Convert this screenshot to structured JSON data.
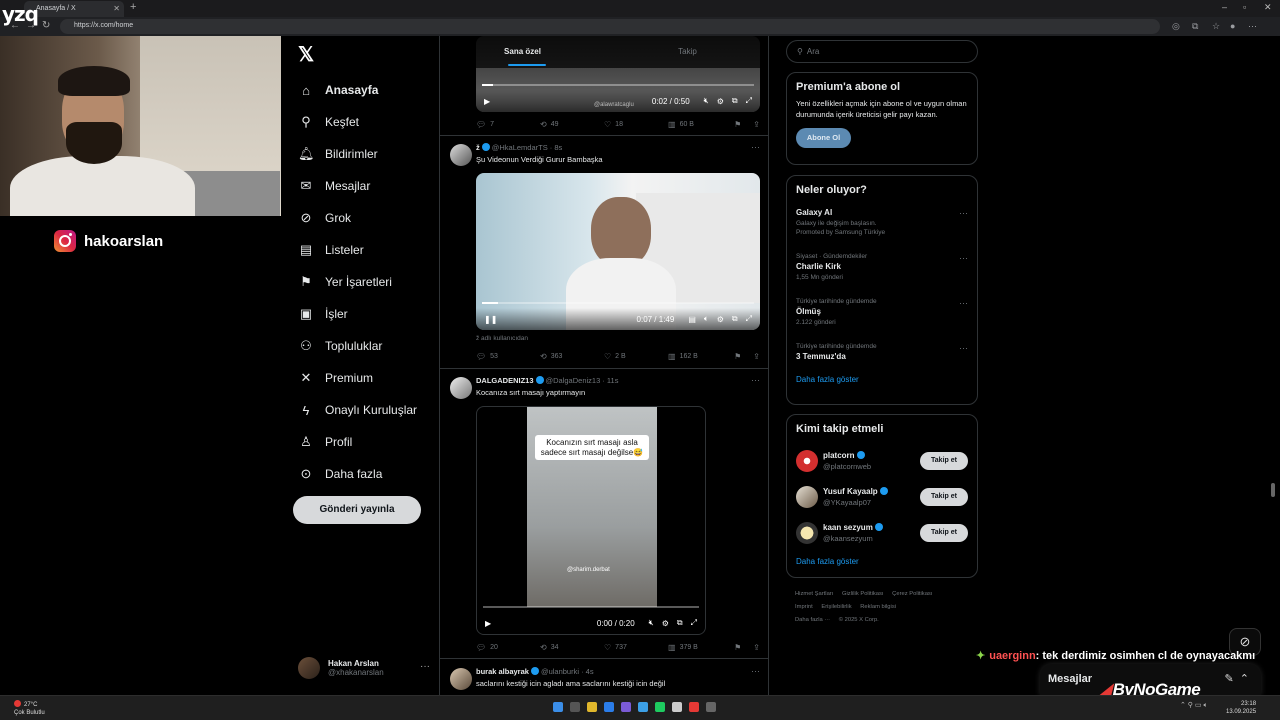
{
  "browser": {
    "tab_title": "Anasayfa / X",
    "url": "https://x.com/home",
    "overlay_logo": "yzq"
  },
  "stream": {
    "instagram_handle": "hakoarslan",
    "chat_user": "uaerginn",
    "chat_text": ": tek derdimiz osimhen cl de oynayacakmı",
    "sponsor": "ByNoGame"
  },
  "nav": {
    "items": [
      {
        "label": "Anasayfa",
        "icon": "home-icon"
      },
      {
        "label": "Keşfet",
        "icon": "search-icon"
      },
      {
        "label": "Bildirimler",
        "icon": "bell-icon"
      },
      {
        "label": "Mesajlar",
        "icon": "mail-icon"
      },
      {
        "label": "Grok",
        "icon": "grok-icon"
      },
      {
        "label": "Listeler",
        "icon": "list-icon"
      },
      {
        "label": "Yer İşaretleri",
        "icon": "bookmark-icon"
      },
      {
        "label": "İşler",
        "icon": "briefcase-icon"
      },
      {
        "label": "Topluluklar",
        "icon": "communities-icon"
      },
      {
        "label": "Premium",
        "icon": "x-icon"
      },
      {
        "label": "Onaylı Kuruluşlar",
        "icon": "lightning-icon"
      },
      {
        "label": "Profil",
        "icon": "person-icon"
      },
      {
        "label": "Daha fazla",
        "icon": "more-circle-icon"
      }
    ],
    "post_button": "Gönderi yayınla",
    "account": {
      "name": "Hakan Arslan",
      "handle": "@xhakanarslan"
    }
  },
  "feed": {
    "tabs": [
      "Sana özel",
      "Takip"
    ],
    "tweets": [
      {
        "video_time": "0:02 / 0:50",
        "watermark": "@alawratcaglu",
        "replies": "7",
        "reposts": "49",
        "likes": "18",
        "views": "60 B"
      },
      {
        "name": "ž",
        "handle": "@HkaLemdarTS · 8s",
        "text": "Şu Videonun Verdiği Gurur Bambaşka",
        "video_time": "0:07 / 1:49",
        "sub_note": "ž adlı kullanıcıdan",
        "replies": "53",
        "reposts": "363",
        "likes": "2 B",
        "views": "162 B"
      },
      {
        "name": "DALGADENIZ13",
        "handle": "@DalgaDeniz13 · 11s",
        "text": "Kocanıza sırt masajı yaptırmayın",
        "caption": "Kocanızın sırt masajı asla sadece sırt masajı değilse😅",
        "video_handle": "@sharim.derbat",
        "video_time": "0:00 / 0:20",
        "replies": "20",
        "reposts": "34",
        "likes": "737",
        "views": "379 B"
      },
      {
        "name": "burak albayrak",
        "handle": "@ulanburki · 4s",
        "text": "saclarını kestiği icin agladı ama saclarını kestiği icin değil"
      }
    ]
  },
  "right": {
    "search_placeholder": "Ara",
    "premium": {
      "title": "Premium'a abone ol",
      "desc": "Yeni özellikleri açmak için abone ol ve uygun olman durumunda içerik üreticisi gelir payı kazan.",
      "button": "Abone Ol"
    },
    "trends_title": "Neler oluyor?",
    "trends": [
      {
        "context": "",
        "title": "Galaxy AI",
        "count": "Galaxy ile değişim başlasın.",
        "extra": "Promoted by Samsung Türkiye"
      },
      {
        "context": "Siyaset · Gündemdekiler",
        "title": "Charlie Kirk",
        "count": "1,55 Mn gönderi"
      },
      {
        "context": "Türkiye tarihinde gündemde",
        "title": "Ölmüş",
        "count": "2.122 gönderi"
      },
      {
        "context": "Türkiye tarihinde gündemde",
        "title": "3 Temmuz'da",
        "count": ""
      }
    ],
    "show_more": "Daha fazla göster",
    "follow_title": "Kimi takip etmeli",
    "follow": [
      {
        "name": "platcorn",
        "handle": "@platcornweb"
      },
      {
        "name": "Yusuf Kayaalp",
        "handle": "@YKayaalp07"
      },
      {
        "name": "kaan sezyum",
        "handle": "@kaansezyum"
      }
    ],
    "follow_button": "Takip et",
    "footer": [
      "Hizmet Şartları",
      "Gizlilik Politikası",
      "Çerez Politikası",
      "Imprint",
      "Erişilebilirlik",
      "Reklam bilgisi",
      "Daha fazla ···",
      "© 2025 X Corp."
    ]
  },
  "dm": {
    "label": "Mesajlar"
  },
  "taskbar": {
    "weather_temp": "27°C",
    "weather_desc": "Çok Bulutlu",
    "time": "23:18",
    "date": "13.09.2025"
  }
}
